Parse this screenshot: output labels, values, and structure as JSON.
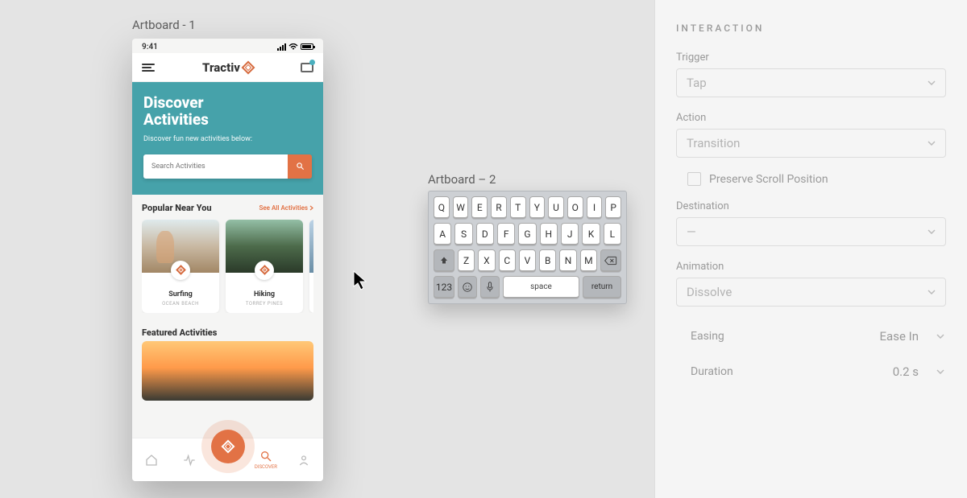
{
  "artboard1": {
    "label": "Artboard - 1",
    "status_time": "9:41",
    "brand": "Tractiv",
    "hero_title_l1": "Discover",
    "hero_title_l2": "Activities",
    "hero_subtitle": "Discover fun new activities below:",
    "search_placeholder": "Search Activities",
    "popular_heading": "Popular Near You",
    "see_all": "See All Activities",
    "cards": [
      {
        "title": "Surfing",
        "sub": "OCEAN BEACH"
      },
      {
        "title": "Hiking",
        "sub": "TORREY PINES"
      }
    ],
    "featured_heading": "Featured Activities",
    "tab_discover": "DISCOVER"
  },
  "artboard2": {
    "label": "Artboard – 2",
    "rows": [
      [
        "Q",
        "W",
        "E",
        "R",
        "T",
        "Y",
        "U",
        "O",
        "I",
        "P"
      ],
      [
        "A",
        "S",
        "D",
        "F",
        "G",
        "H",
        "J",
        "K",
        "L"
      ],
      [
        "Z",
        "X",
        "C",
        "V",
        "B",
        "N",
        "M"
      ]
    ],
    "num": "123",
    "space": "space",
    "return": "return"
  },
  "panel": {
    "title": "INTERACTION",
    "trigger_label": "Trigger",
    "trigger_value": "Tap",
    "action_label": "Action",
    "action_value": "Transition",
    "preserve": "Preserve Scroll Position",
    "destination_label": "Destination",
    "destination_value": "—",
    "animation_label": "Animation",
    "animation_value": "Dissolve",
    "easing_label": "Easing",
    "easing_value": "Ease In",
    "duration_label": "Duration",
    "duration_value": "0.2 s"
  }
}
